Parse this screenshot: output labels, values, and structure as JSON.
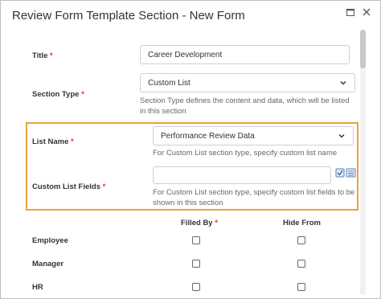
{
  "dialog": {
    "title": "Review Form Template Section - New Form"
  },
  "fields": {
    "title": {
      "label": "Title",
      "required_mark": "*",
      "value": "Career Development"
    },
    "section_type": {
      "label": "Section Type",
      "required_mark": "*",
      "value": "Custom List",
      "help": "Section Type defines the content and data, which will be listed in this section"
    },
    "list_name": {
      "label": "List Name",
      "required_mark": "*",
      "value": "Performance Review Data",
      "help": "For Custom List section type, specify custom list name"
    },
    "custom_list_fields": {
      "label": "Custom List Fields",
      "required_mark": "*",
      "value": "",
      "help": "For Custom List section type, specify custom list fields to be shown in this section"
    }
  },
  "permissions": {
    "columns": {
      "filled_by": "Filled By",
      "filled_by_required": "*",
      "hide_from": "Hide From"
    },
    "rows": [
      {
        "label": "Employee",
        "filled_by": false,
        "hide_from": false
      },
      {
        "label": "Manager",
        "filled_by": false,
        "hide_from": false
      },
      {
        "label": "HR",
        "filled_by": false,
        "hide_from": false
      }
    ]
  },
  "icons": {
    "maximize": "maximize-icon",
    "close": "close-icon",
    "field_picker": "field-picker-icon"
  },
  "colors": {
    "highlight": "#e8a33a",
    "required": "#d9322b"
  }
}
